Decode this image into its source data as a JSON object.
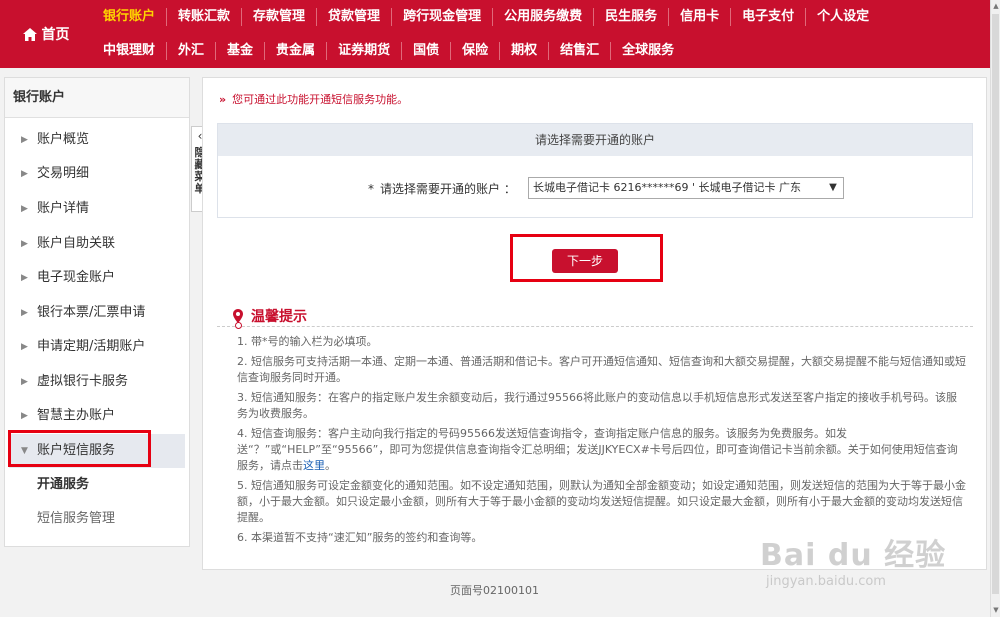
{
  "topnav": {
    "home_label": "首页",
    "row1": [
      "银行账户",
      "转账汇款",
      "存款管理",
      "贷款管理",
      "跨行现金管理",
      "公用服务缴费",
      "民生服务",
      "信用卡",
      "电子支付",
      "个人设定"
    ],
    "row2": [
      "中银理财",
      "外汇",
      "基金",
      "贵金属",
      "证券期货",
      "国债",
      "保险",
      "期权",
      "结售汇",
      "全球服务"
    ],
    "active": "银行账户"
  },
  "sidebar": {
    "title": "银行账户",
    "items": [
      "账户概览",
      "交易明细",
      "账户详情",
      "账户自助关联",
      "电子现金账户",
      "银行本票/汇票申请",
      "申请定期/活期账户",
      "虚拟银行卡服务",
      "智慧主办账户",
      "账户短信服务"
    ],
    "subitems": [
      "开通服务",
      "短信服务管理"
    ],
    "hide_tab": "隐藏菜单"
  },
  "main": {
    "notice_mark": "»",
    "notice": "您可通过此功能开通短信服务功能。",
    "panel_title": "请选择需要开通的账户",
    "field_required": "*",
    "field_label": "请选择需要开通的账户 ：",
    "select_value": "长城电子借记卡  6216******69  ' 长城电子借记卡  广东",
    "next_button": "下一步",
    "tips_title": "温馨提示",
    "tips": [
      "1. 带*号的输入栏为必填项。",
      "2. 短信服务可支持活期一本通、定期一本通、普通活期和借记卡。客户可开通短信通知、短信查询和大额交易提醒，大额交易提醒不能与短信通知或短信查询服务同时开通。",
      "3. 短信通知服务：在客户的指定账户发生余额变动后，我行通过95566将此账户的变动信息以手机短信息形式发送至客户指定的接收手机号码。该服务为收费服务。",
      "4. 短信查询服务：客户主动向我行指定的号码95566发送短信查询指令，查询指定账户信息的服务。该服务为免费服务。如发送“？”或“HELP”至“95566”，即可为您提供信息查询指令汇总明细；发送JJKYECX#卡号后四位，即可查询借记卡当前余额。关于如何使用短信查询服务，请点击",
      "5. 短信通知服务可设定金额变化的通知范围。如不设定通知范围，则默认为通知全部金额变动；如设定通知范围，则发送短信的范围为大于等于最小金额，小于最大金额。如只设定最小金额，则所有大于等于最小金额的变动均发送短信提醒。如只设定最大金额，则所有小于最大金额的变动均发送短信提醒。",
      "6. 本渠道暂不支持“速汇知”服务的签约和查询等。"
    ],
    "tips_link": "这里",
    "tips_after_link": "。"
  },
  "footer": "页面号02100101",
  "watermark": {
    "brand": "Bai du 经验",
    "url": "jingyan.baidu.com"
  },
  "colors": {
    "brand_red": "#c8102e",
    "active_nav": "#ffd400",
    "highlight": "#e60012"
  },
  "icons": [
    "home-icon",
    "location-pin-icon",
    "chevron-left-icon",
    "caret-down-icon",
    "triangle-right-icon"
  ]
}
